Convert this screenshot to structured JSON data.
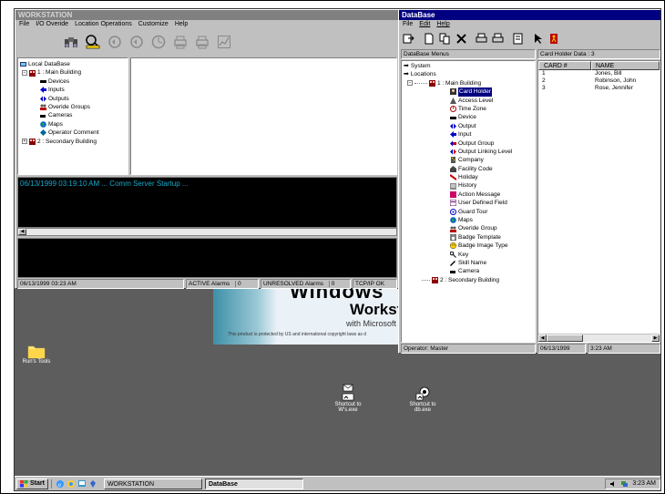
{
  "workstation": {
    "title": "WORKSTATION",
    "menu": [
      "File",
      "I/O Overide",
      "Location Operations",
      "Customize",
      "Help"
    ],
    "tree": {
      "root": "Local DataBase",
      "building1": "1 : Main Building",
      "items": [
        "Devices",
        "Inputs",
        "Outputs",
        "Overide Groups",
        "Cameras",
        "Maps",
        "Operator Comment"
      ],
      "building2": "2 : Secondary Building"
    },
    "log_line": "06/13/1999 03:19:10 AM ... Comm Server Startup ...",
    "status": {
      "datetime": "06/13/1999 03:23 AM",
      "active_label": "ACTIVE Alarms",
      "active_value": "0",
      "unresolved_label": "UNRESOLVED Alarms",
      "unresolved_value": "0",
      "tcpip": "TCP/IP OK"
    }
  },
  "splash": {
    "windows_word": "Windows",
    "workstation_word": "Workstat",
    "with_ms": "with Microsoft I",
    "copyright": "This product is protected by US and international copyright laws as d"
  },
  "database": {
    "title": "DataBase",
    "menu": [
      "File",
      "Edit",
      "Help"
    ],
    "menus_header": "DataBase Menus",
    "data_header": "Card Holder Data : 3",
    "tree_top": [
      "System",
      "Locations"
    ],
    "building1": "1 : Main Building",
    "items": [
      "Card Holder",
      "Access Level",
      "Time Zone",
      "Device",
      "Output",
      "Input",
      "Output Group",
      "Output Linking Level",
      "Company",
      "Facility Code",
      "Holiday",
      "History",
      "Action Message",
      "User Defined Field",
      "Guard Tour",
      "Maps",
      "Overide Group",
      "Badge Template",
      "Badge Image Type",
      "Key",
      "Skill Name",
      "Camera"
    ],
    "building2": "2 : Secondary Building",
    "columns": [
      "CARD #",
      "NAME"
    ],
    "rows": [
      {
        "card": "1",
        "name": "Jones, Bill"
      },
      {
        "card": "2",
        "name": "Robinson, John"
      },
      {
        "card": "3",
        "name": "Rose, Jennifer"
      }
    ],
    "status": {
      "operator": "Operator:  Master",
      "date": "06/13/1999",
      "time": "3:23 AM"
    }
  },
  "desktop": {
    "folder_label": "Run's Tools",
    "shortcut1": [
      "Shortcut to",
      "W's.exe"
    ],
    "shortcut2": [
      "Shortcut to",
      "db.exe"
    ]
  },
  "taskbar": {
    "start": "Start",
    "tasks": [
      "WORKSTATION",
      "DataBase"
    ],
    "clock": "3:23 AM"
  }
}
